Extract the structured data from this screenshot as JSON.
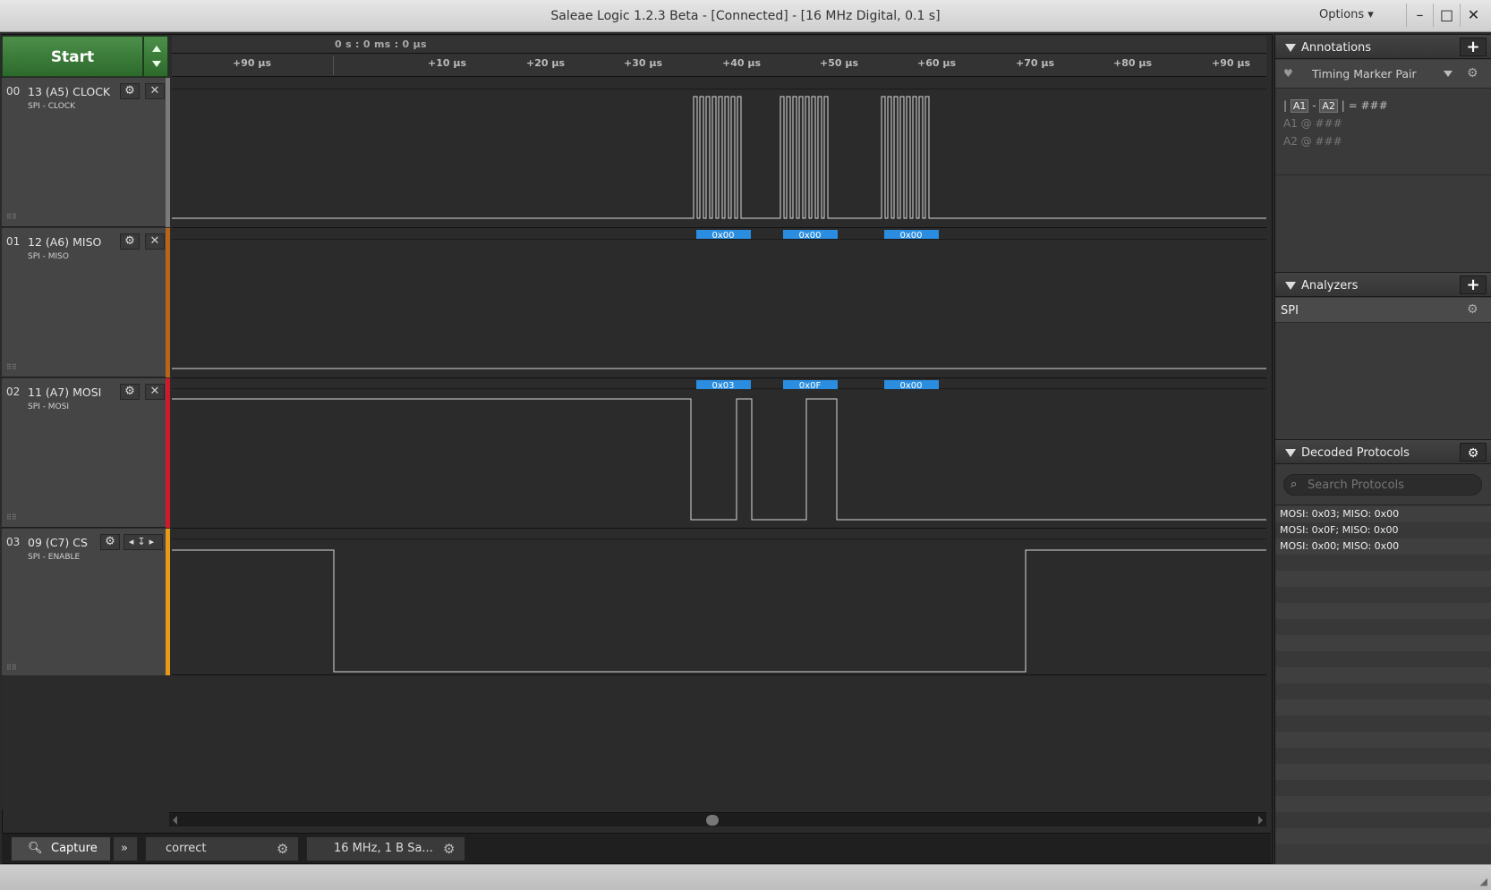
{
  "window": {
    "title": "Saleae Logic 1.2.3 Beta - [Connected] - [16 MHz Digital, 0.1 s]",
    "options_label": "Options ▾",
    "min_symbol": "–",
    "max_symbol": "□",
    "close_symbol": "✕"
  },
  "capture": {
    "start_label": "Start"
  },
  "ruler": {
    "time_origin": "0 s : 0 ms : 0 µs",
    "ticks": [
      "+90 µs",
      "+10 µs",
      "+20 µs",
      "+30 µs",
      "+40 µs",
      "+50 µs",
      "+60 µs",
      "+70 µs",
      "+80 µs",
      "+90 µs"
    ]
  },
  "channels": [
    {
      "num": "00",
      "name": "13 (A5) CLOCK",
      "sub": "SPI - CLOCK",
      "color": "#7a7a7a",
      "icon": "gear-icon"
    },
    {
      "num": "01",
      "name": "12 (A6) MISO",
      "sub": "SPI - MISO",
      "color": "#b8651a",
      "icon": "gear-icon"
    },
    {
      "num": "02",
      "name": "11 (A7) MOSI",
      "sub": "SPI - MOSI",
      "color": "#d01a2a",
      "icon": "gear-icon"
    },
    {
      "num": "03",
      "name": "09 (C7) CS",
      "sub": "SPI - ENABLE",
      "color": "#e79a1a",
      "icon": "gear-icon"
    }
  ],
  "decoded_labels": {
    "miso": [
      "0x00",
      "0x00",
      "0x00"
    ],
    "mosi": [
      "0x03",
      "0x0F",
      "0x00"
    ],
    "color": "#2a8de0"
  },
  "bottom_tabs": {
    "capture_label": "Capture",
    "expand_symbol": "»",
    "tab1_label": "correct",
    "tab2_label": "16 MHz, 1 B Sa..."
  },
  "annotations": {
    "title": "Annotations",
    "timing_label": "Timing Marker Pair",
    "formula_sep1": "|",
    "formula_a1": "A1",
    "formula_dash": "-",
    "formula_a2": "A2",
    "formula_eq": "| = ###",
    "a1_line": "A1  @  ###",
    "a2_line": "A2  @  ###"
  },
  "analyzers": {
    "title": "Analyzers",
    "items": [
      "SPI"
    ]
  },
  "decoded_protocols": {
    "title": "Decoded Protocols",
    "search_placeholder": "Search Protocols",
    "rows": [
      "MOSI: 0x03;  MISO: 0x00",
      "MOSI: 0x0F;  MISO: 0x00",
      "MOSI: 0x00;  MISO: 0x00"
    ]
  }
}
